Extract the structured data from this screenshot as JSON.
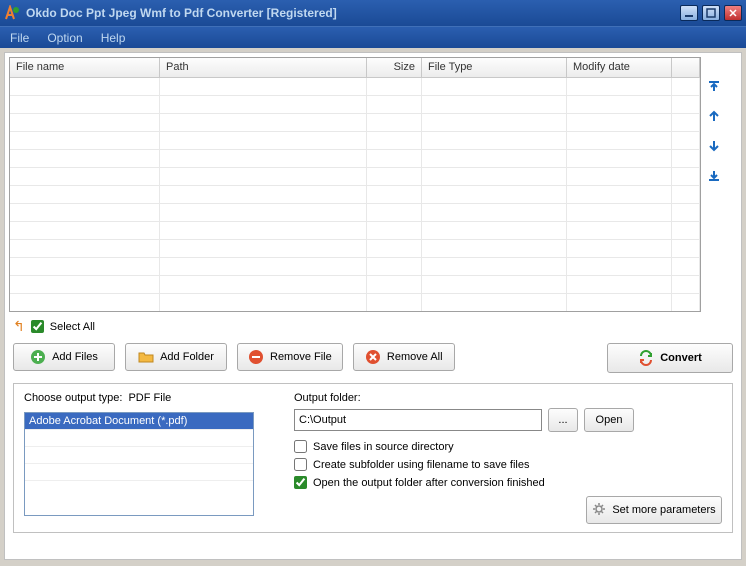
{
  "window": {
    "title": "Okdo Doc Ppt Jpeg Wmf to Pdf Converter [Registered]"
  },
  "menu": {
    "file": "File",
    "option": "Option",
    "help": "Help"
  },
  "table": {
    "headers": {
      "filename": "File name",
      "path": "Path",
      "size": "Size",
      "filetype": "File Type",
      "modify": "Modify date"
    }
  },
  "selectall": {
    "label": "Select All",
    "checked": true
  },
  "buttons": {
    "addfiles": "Add Files",
    "addfolder": "Add Folder",
    "removefile": "Remove File",
    "removeall": "Remove All",
    "convert": "Convert"
  },
  "output": {
    "choose_label": "Choose output type:",
    "pdf_label": "PDF File",
    "format_item": "Adobe Acrobat Document (*.pdf)",
    "folder_label": "Output folder:",
    "folder_value": "C:\\Output",
    "browse": "...",
    "open": "Open",
    "save_source": "Save files in source directory",
    "create_sub": "Create subfolder using filename to save files",
    "open_after": "Open the output folder after conversion finished",
    "more_params": "Set more parameters"
  },
  "checks": {
    "save_source": false,
    "create_sub": false,
    "open_after": true
  }
}
